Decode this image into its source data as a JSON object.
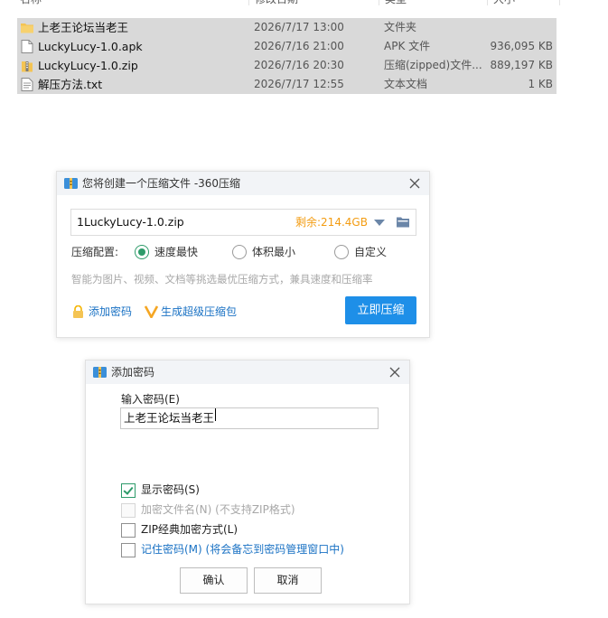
{
  "file_list": {
    "columns": [
      "名称",
      "修改日期",
      "类型",
      "大小"
    ],
    "rows": [
      {
        "name": "上老王论坛当老王",
        "date": "2026/7/17 13:00",
        "type": "文件夹",
        "size": "",
        "icon": "folder-icon"
      },
      {
        "name": "LuckyLucy-1.0.apk",
        "date": "2026/7/16 21:00",
        "type": "APK 文件",
        "size": "936,095 KB",
        "icon": "file-icon"
      },
      {
        "name": "LuckyLucy-1.0.zip",
        "date": "2026/7/16 20:30",
        "type": "压缩(zipped)文件...",
        "size": "889,197 KB",
        "icon": "zip-icon"
      },
      {
        "name": "解压方法.txt",
        "date": "2026/7/17 12:55",
        "type": "文本文档",
        "size": "1 KB",
        "icon": "text-file-icon"
      }
    ]
  },
  "compress_dialog": {
    "title": "您将创建一个压缩文件 -360压缩",
    "filename": "1LuckyLucy-1.0.zip",
    "free_space": "剩余:214.4GB",
    "config_label": "压缩配置:",
    "options": [
      {
        "label": "速度最快",
        "selected": true
      },
      {
        "label": "体积最小",
        "selected": false
      },
      {
        "label": "自定义",
        "selected": false
      }
    ],
    "hint": "智能为图片、视频、文档等挑选最优压缩方式，兼具速度和压缩率",
    "add_password": "添加密码",
    "super_package": "生成超级压缩包",
    "compress_button": "立即压缩",
    "accent_color": "#1e8fe8",
    "free_color": "#f39c12"
  },
  "password_dialog": {
    "title": "添加密码",
    "input_label": "输入密码(E)",
    "input_value": "上老王论坛当老王",
    "checkboxes": [
      {
        "label": "显示密码(S)",
        "checked": true,
        "disabled": false
      },
      {
        "label": "加密文件名(N) (不支持ZIP格式)",
        "checked": false,
        "disabled": true
      },
      {
        "label": "ZIP经典加密方式(L)",
        "checked": false,
        "disabled": false
      },
      {
        "label": "记住密码(M) (将会备忘到密码管理窗口中)",
        "checked": false,
        "disabled": false
      }
    ],
    "ok_button": "确认",
    "cancel_button": "取消"
  }
}
